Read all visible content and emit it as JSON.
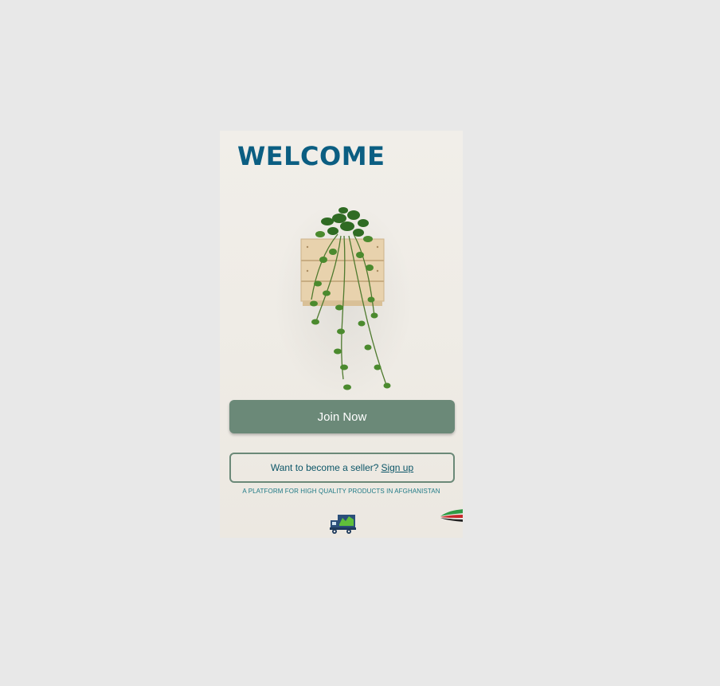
{
  "screen": {
    "title": "WELCOME",
    "join_button_label": "Join Now",
    "seller_prompt": "Want to become a seller?",
    "seller_link": "Sign up",
    "tagline": "A PLATFORM FOR HIGH QUALITY PRODUCTS IN AFGHANISTAN"
  },
  "icons": {
    "hero": "hanging-plant-icon",
    "logo": "delivery-truck-icon",
    "corner": "flag-swoosh-icon"
  },
  "colors": {
    "title": "#0b5e82",
    "primary_button": "#6b8978",
    "link_text": "#0c5668",
    "tagline": "#1f7a86"
  }
}
